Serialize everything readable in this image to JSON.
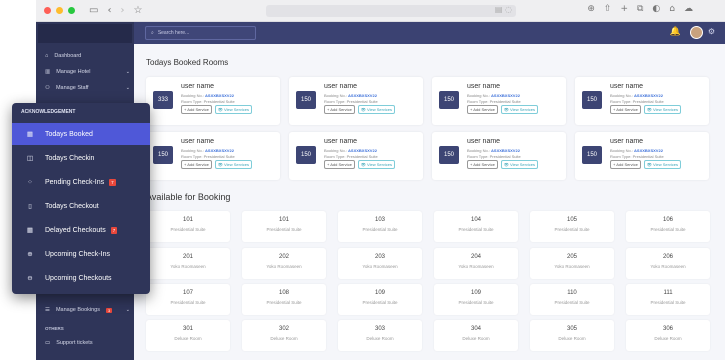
{
  "sidebar": {
    "items": [
      {
        "label": "Dashboard",
        "icon": "home-icon"
      },
      {
        "label": "Manage Hotel",
        "icon": "building-icon"
      },
      {
        "label": "Manage Staff",
        "icon": "users-icon"
      }
    ],
    "bookings_label": "Manage Bookings",
    "bookings_badge": "3",
    "others_label": "OTHERS",
    "support_label": "Support tickets"
  },
  "topbar": {
    "search_placeholder": "Search here..."
  },
  "booked": {
    "title": "Todays Booked Rooms",
    "cards": [
      {
        "room": "333",
        "name": "user name",
        "booking_prefix": "Booking No.: ",
        "booking": "ASXXBXSXV22",
        "room_type": "Room Type: Presidential Suite",
        "add": "+ Add Service",
        "view": "👁 View Services"
      },
      {
        "room": "150",
        "name": "user name",
        "booking_prefix": "Booking No.: ",
        "booking": "ASXXBXSXV22",
        "room_type": "Room Type: Presidential Suite",
        "add": "+ Add Service",
        "view": "👁 View Services"
      },
      {
        "room": "150",
        "name": "user name",
        "booking_prefix": "Booking No.: ",
        "booking": "ASXXBXSXV22",
        "room_type": "Room Type: Presidential Suite",
        "add": "+ Add Service",
        "view": "👁 View Services"
      },
      {
        "room": "150",
        "name": "user name",
        "booking_prefix": "Booking No.: ",
        "booking": "ASXXBXSXV22",
        "room_type": "Room Type: Presidential Suite",
        "add": "+ Add Service",
        "view": "👁 View Services"
      },
      {
        "room": "150",
        "name": "user name",
        "booking_prefix": "Booking No.: ",
        "booking": "ASXXBXSXV22",
        "room_type": "Room Type: Presidential Suite",
        "add": "+ Add Service",
        "view": "👁 View Services"
      },
      {
        "room": "150",
        "name": "user name",
        "booking_prefix": "Booking No.: ",
        "booking": "ASXXBXSXV22",
        "room_type": "Room Type: Presidential Suite",
        "add": "+ Add Service",
        "view": "👁 View Services"
      },
      {
        "room": "150",
        "name": "user name",
        "booking_prefix": "Booking No.: ",
        "booking": "ASXXBXSXV22",
        "room_type": "Room Type: Presidential Suite",
        "add": "+ Add Service",
        "view": "👁 View Services"
      },
      {
        "room": "150",
        "name": "user name",
        "booking_prefix": "Booking No.: ",
        "booking": "ASXXBXSXV22",
        "room_type": "Room Type: Presidential Suite",
        "add": "+ Add Service",
        "view": "👁 View Services"
      }
    ]
  },
  "available": {
    "title": "Available for Booking",
    "rows": [
      [
        {
          "n": "101",
          "t": "Presidential Suite"
        },
        {
          "n": "101",
          "t": "Presidential Suite"
        },
        {
          "n": "103",
          "t": "Presidential Suite"
        },
        {
          "n": "104",
          "t": "Presidential Suite"
        },
        {
          "n": "105",
          "t": "Presidential Suite"
        },
        {
          "n": "106",
          "t": "Presidential Suite"
        }
      ],
      [
        {
          "n": "201",
          "t": "Yoko Roomaseen"
        },
        {
          "n": "202",
          "t": "Yoko Roomaseen"
        },
        {
          "n": "203",
          "t": "Yoko Roomaseen"
        },
        {
          "n": "204",
          "t": "Yoko Roomaseen"
        },
        {
          "n": "205",
          "t": "Yoko Roomaseen"
        },
        {
          "n": "206",
          "t": "Yoko Roomaseen"
        }
      ],
      [
        {
          "n": "107",
          "t": "Presidential Suite"
        },
        {
          "n": "108",
          "t": "Presidential Suite"
        },
        {
          "n": "109",
          "t": "Presidential Suite"
        },
        {
          "n": "109",
          "t": "Presidential Suite"
        },
        {
          "n": "110",
          "t": "Presidential Suite"
        },
        {
          "n": "111",
          "t": "Presidential Suite"
        }
      ],
      [
        {
          "n": "301",
          "t": "Deluxe Room"
        },
        {
          "n": "302",
          "t": "Deluxe Room"
        },
        {
          "n": "303",
          "t": "Deluxe Room"
        },
        {
          "n": "304",
          "t": "Deluxe Room"
        },
        {
          "n": "305",
          "t": "Deluxe Room"
        },
        {
          "n": "306",
          "t": "Deluxe Room"
        }
      ]
    ]
  },
  "popup": {
    "title": "ACKNOWLEDGEMENT",
    "items": [
      {
        "label": "Todays Booked",
        "icon": "calendar-icon",
        "glyph": "▦",
        "active": true
      },
      {
        "label": "Todays Checkin",
        "icon": "door-icon",
        "glyph": "◫"
      },
      {
        "label": "Pending Check-Ins",
        "icon": "spinner-icon",
        "glyph": "⁘",
        "badge": "7"
      },
      {
        "label": "Todays Checkout",
        "icon": "door-open-icon",
        "glyph": "▯"
      },
      {
        "label": "Delayed Checkouts",
        "icon": "calendar-x-icon",
        "glyph": "▦",
        "badge": "7"
      },
      {
        "label": "Upcoming Check-Ins",
        "icon": "arrow-in-icon",
        "glyph": "⊕"
      },
      {
        "label": "Upcoming Checkouts",
        "icon": "arrow-out-icon",
        "glyph": "⊖"
      }
    ]
  },
  "colors": {
    "sidebar": "#2f3559",
    "topbar": "#3b4272",
    "accent": "#4f58d8",
    "badge": "#e8473b"
  }
}
